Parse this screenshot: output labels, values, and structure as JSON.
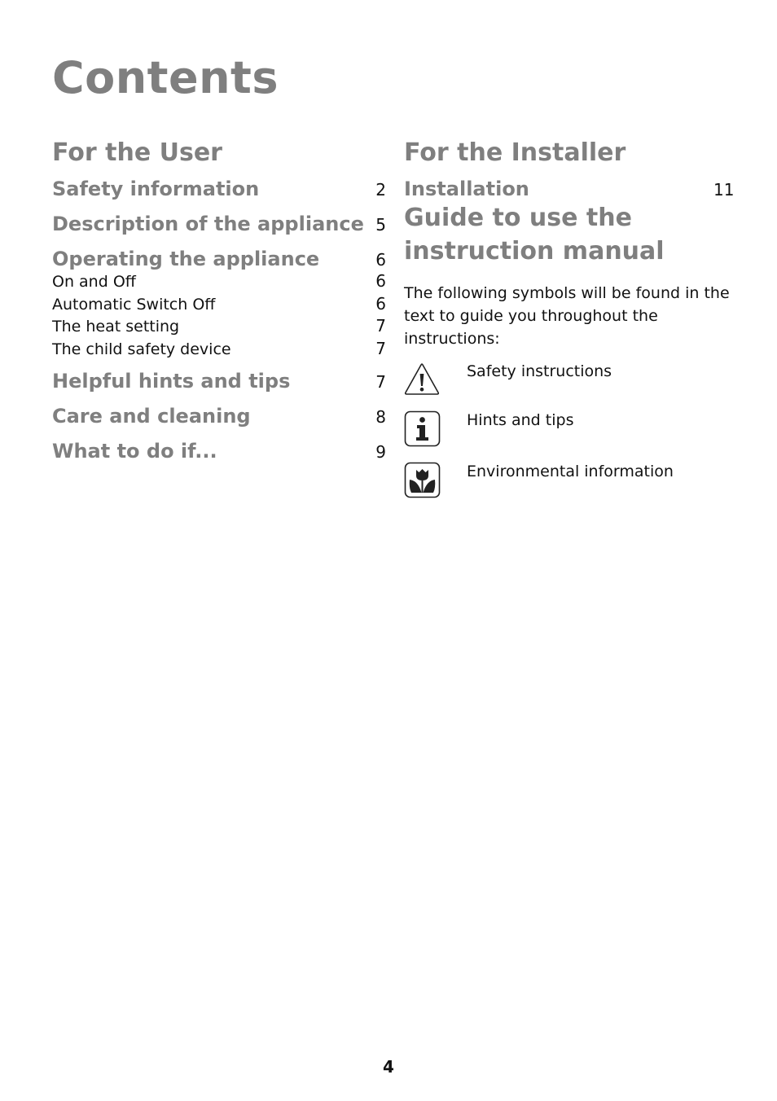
{
  "page_title": "Contents",
  "user_section": {
    "heading": "For the User",
    "entries": [
      {
        "label": "Safety information",
        "page": "2",
        "level": "main"
      },
      {
        "label": "Description of the appliance",
        "page": "5",
        "level": "main"
      },
      {
        "label": "Operating the appliance",
        "page": "6",
        "level": "main"
      },
      {
        "label": "On and Off",
        "page": "6",
        "level": "sub"
      },
      {
        "label": "Automatic Switch Off",
        "page": "6",
        "level": "sub"
      },
      {
        "label": "The heat setting",
        "page": "7",
        "level": "sub"
      },
      {
        "label": "The child safety device",
        "page": "7",
        "level": "sub"
      },
      {
        "label": "Helpful hints and tips",
        "page": "7",
        "level": "main"
      },
      {
        "label": "Care and cleaning",
        "page": "8",
        "level": "main"
      },
      {
        "label": "What to do if...",
        "page": "9",
        "level": "main"
      }
    ]
  },
  "installer_section": {
    "heading": "For the Installer",
    "entries": [
      {
        "label": "Installation",
        "page": "11"
      }
    ]
  },
  "guide_section": {
    "heading_line1": "Guide to use the",
    "heading_line2": "instruction manual",
    "intro": "The following symbols will be found in the text to guide you throughout the instructions:",
    "symbols": [
      {
        "icon": "warning-triangle-icon",
        "label": "Safety instructions"
      },
      {
        "icon": "info-icon",
        "label": "Hints and tips"
      },
      {
        "icon": "tulip-flower-icon",
        "label": "Environmental information"
      }
    ]
  },
  "footer": {
    "page_number": "4"
  },
  "colors": {
    "heading_gray": "#7f7f7f",
    "text": "#111111"
  }
}
